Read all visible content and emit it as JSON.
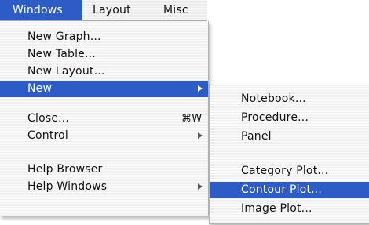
{
  "menubar": {
    "items": [
      {
        "label": "Windows"
      },
      {
        "label": "Layout"
      },
      {
        "label": "Misc"
      }
    ]
  },
  "windows_menu": {
    "items": [
      {
        "label": "New Graph..."
      },
      {
        "label": "New Table..."
      },
      {
        "label": "New Layout..."
      },
      {
        "label": "New",
        "has_submenu": true,
        "highlighted": true
      },
      {
        "label": "Close...",
        "shortcut": "⌘W"
      },
      {
        "label": "Control",
        "has_submenu": true
      },
      {
        "label": "Help Browser"
      },
      {
        "label": "Help Windows",
        "has_submenu": true
      }
    ]
  },
  "new_submenu": {
    "items": [
      {
        "label": "Notebook..."
      },
      {
        "label": "Procedure..."
      },
      {
        "label": "Panel"
      },
      {
        "label": "Category Plot..."
      },
      {
        "label": "Contour Plot...",
        "highlighted": true
      },
      {
        "label": "Image Plot..."
      }
    ]
  },
  "colors": {
    "highlight": "#2d5cc6",
    "highlight_text": "#ffffff",
    "arrow": "#555555"
  }
}
